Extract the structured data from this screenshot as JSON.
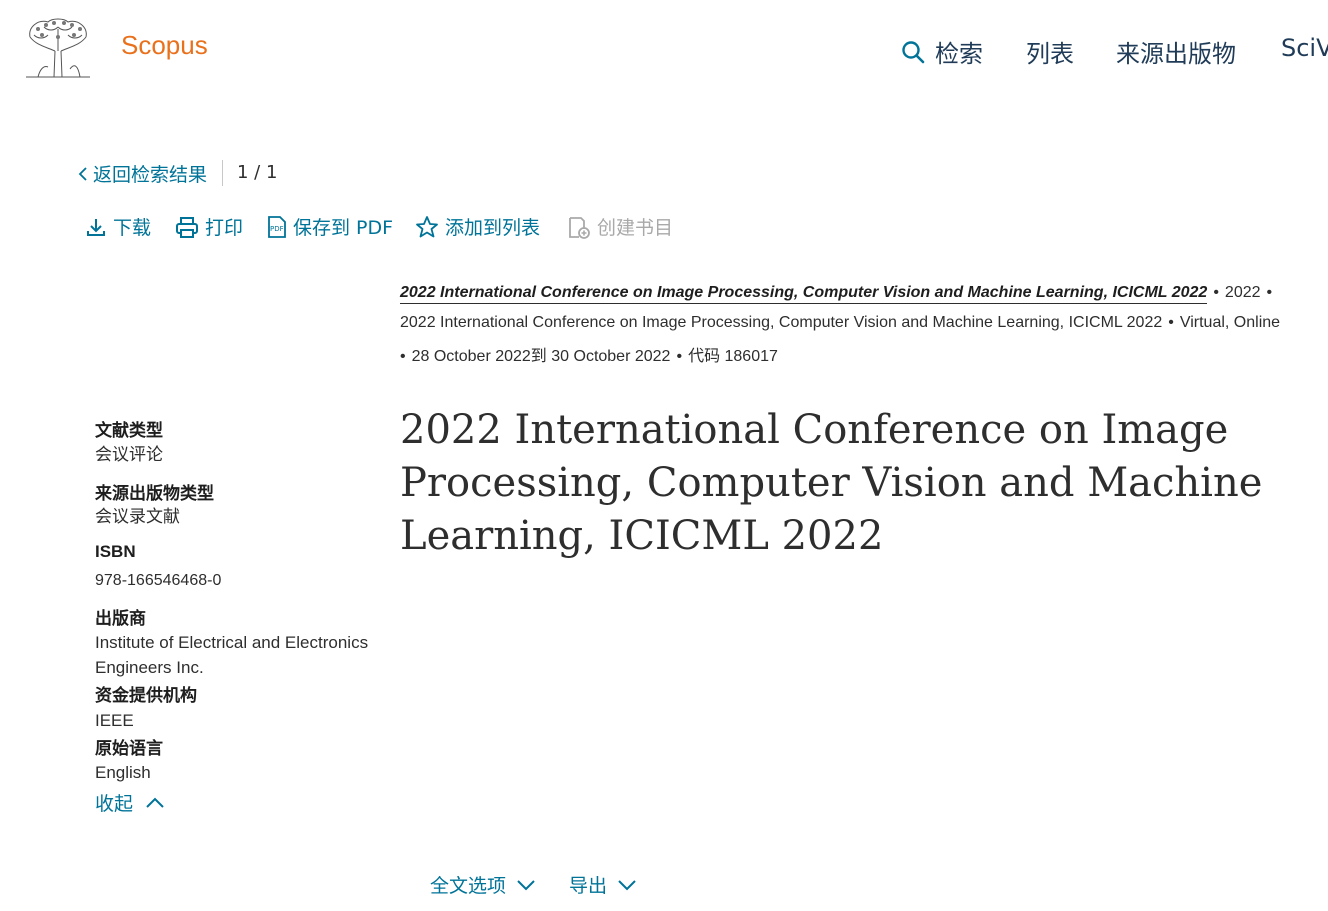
{
  "header": {
    "brand": "Scopus",
    "nav": [
      "检索",
      "列表",
      "来源出版物",
      "SciVal"
    ]
  },
  "breadcrumb": {
    "back_label": "返回检索结果",
    "pager": "1 / 1"
  },
  "toolbar": {
    "download": "下载",
    "print": "打印",
    "save_pdf": "保存到 PDF",
    "add_list": "添加到列表",
    "create_bib": "创建书目"
  },
  "source": {
    "title": "2022 International Conference on Image Processing, Computer Vision and Machine Learning, ICICML 2022",
    "year": "2022",
    "conference": "2022 International Conference on Image Processing, Computer Vision and Machine Learning, ICICML 2022",
    "location": "Virtual, Online",
    "dates": "28 October 2022到 30 October 2022",
    "code": "代码 186017"
  },
  "document_title": "2022 International Conference on Image Processing, Computer Vision and Machine Learning, ICICML 2022",
  "meta": {
    "doc_type_label": "文献类型",
    "doc_type": "会议评论",
    "source_type_label": "来源出版物类型",
    "source_type": "会议录文献",
    "isbn_label": "ISBN",
    "isbn": "978-166546468-0",
    "publisher_label": "出版商",
    "publisher": "Institute of Electrical and Electronics Engineers Inc.",
    "funding_label": "资金提供机构",
    "funding": "IEEE",
    "language_label": "原始语言",
    "language": "English",
    "collapse": "收起"
  },
  "bottom": {
    "full_text_options": "全文选项",
    "export": "导出"
  },
  "colors": {
    "brand": "#e9711c",
    "link": "#007398",
    "nav": "#1f3b57"
  }
}
